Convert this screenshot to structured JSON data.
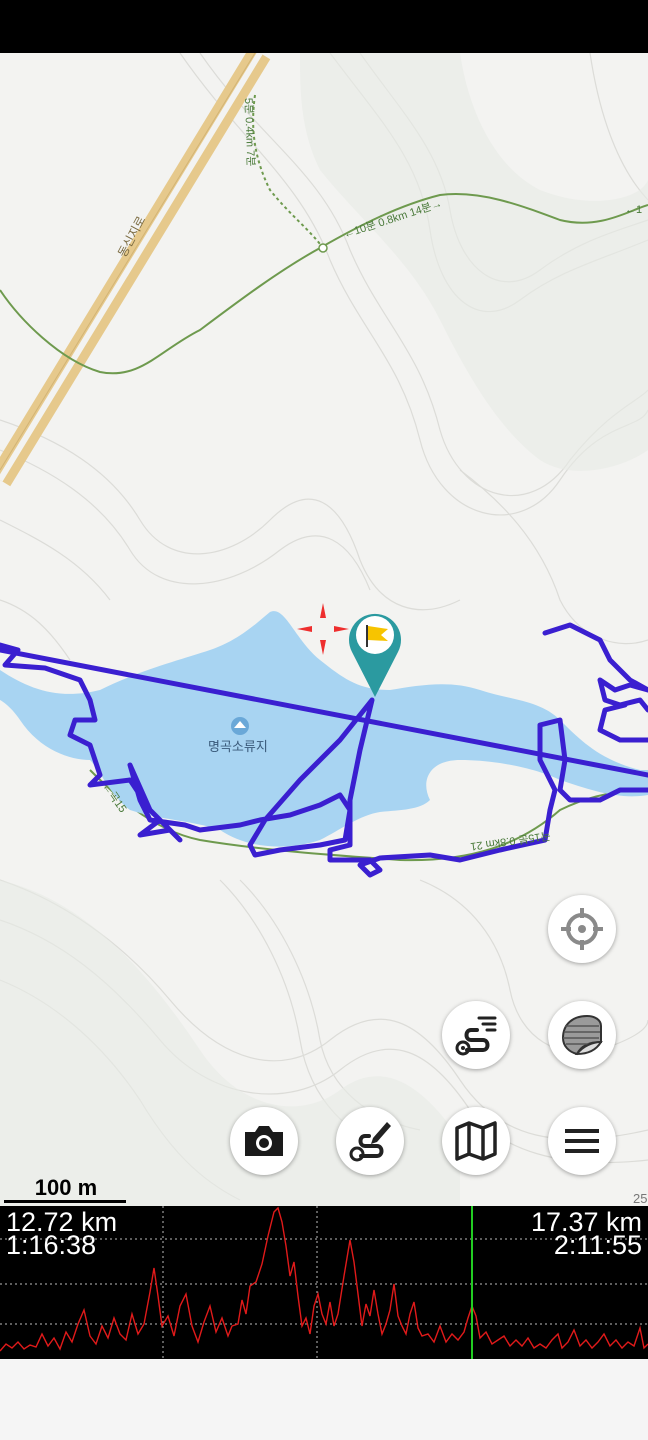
{
  "map": {
    "reservoir_label": "명곡소류지",
    "road_label": "동신지로",
    "trail_labels": [
      "5분 0.4km 7분",
      "←10분 0.8km 14분→",
      "←1",
      "←곡15",
      "곡15분 0.8km 21"
    ],
    "edge_number": "25",
    "scale_label": "100 m",
    "colors": {
      "water": "#a8d4f2",
      "track": "#3a1fd0",
      "trail": "#6e9a4e",
      "road": "#e6c98c",
      "marker": "#2b9aa0",
      "crosshair": "#ee2e2e"
    }
  },
  "buttons": {
    "locate": "crosshair-icon",
    "layers": "layers-icon",
    "routes": "route-list-icon",
    "camera": "camera-icon",
    "draw_route": "draw-route-icon",
    "maps": "map-icon",
    "menu": "menu-icon"
  },
  "profile": {
    "left_distance": "12.72 km",
    "left_time": "1:16:38",
    "right_distance": "17.37 km",
    "right_time": "2:11:55",
    "cursor_fraction": 0.728,
    "colors": {
      "line": "#e01a1a",
      "cursor": "#22cc22",
      "grid": "#bbbbbb"
    }
  }
}
